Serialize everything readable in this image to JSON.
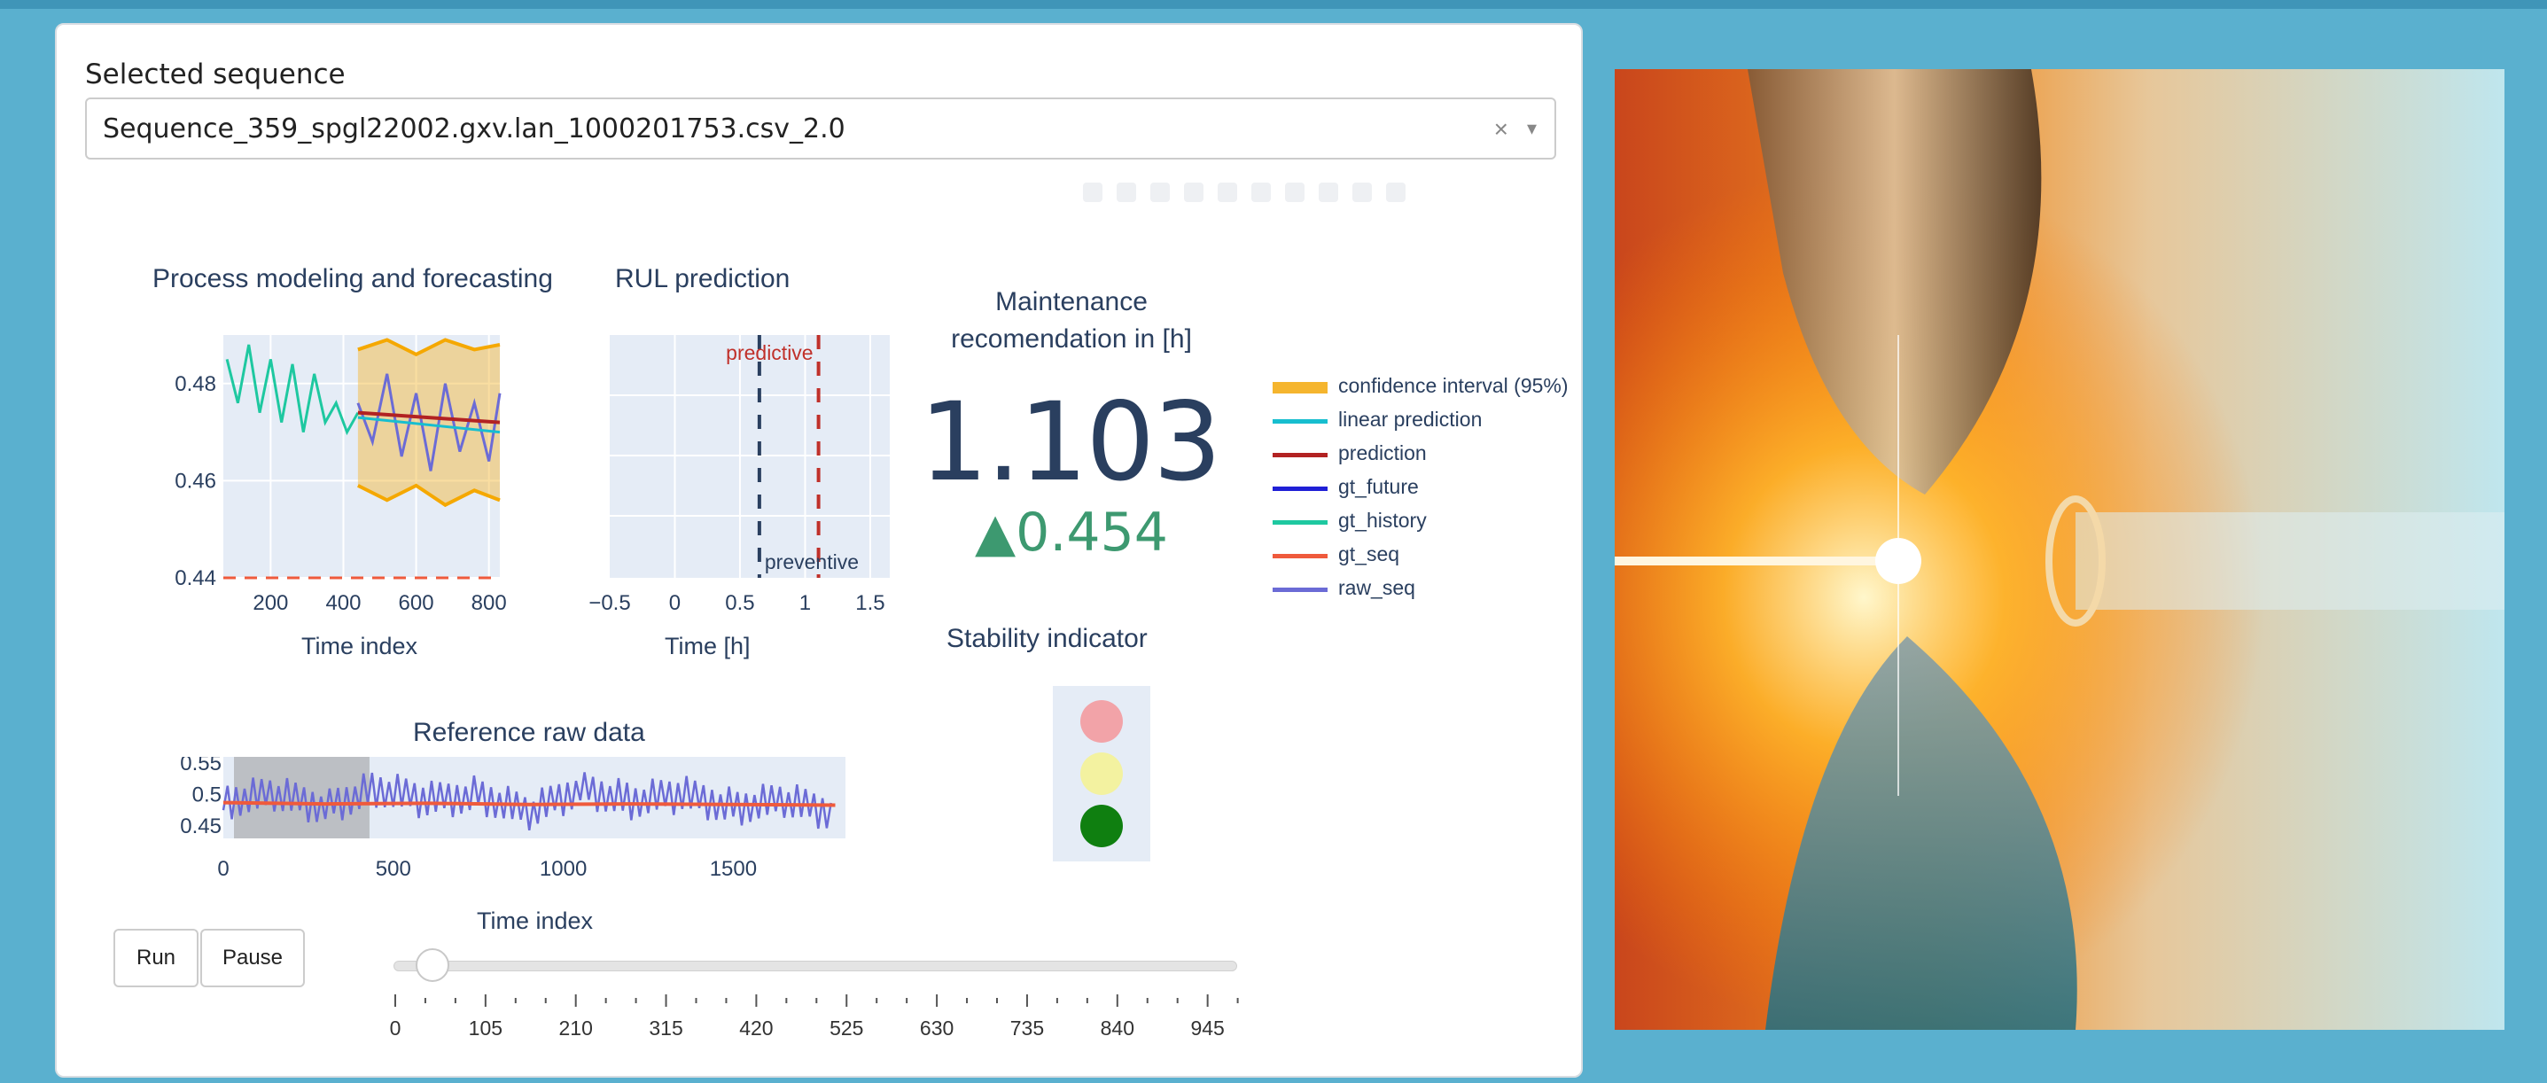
{
  "selector": {
    "label": "Selected sequence",
    "value": "Sequence_359_spgl22002.gxv.lan_1000201753.csv_2.0",
    "clear_icon": "×",
    "caret_icon": "▾"
  },
  "forecast_plot": {
    "title": "Process modeling and forecasting",
    "x_title": "Time index",
    "x_ticks": [
      "200",
      "400",
      "600",
      "800"
    ],
    "y_ticks": [
      "0.48",
      "0.46",
      "0.44"
    ]
  },
  "rul_plot": {
    "title": "RUL prediction",
    "x_title": "Time [h]",
    "x_ticks": [
      "−0.5",
      "0",
      "0.5",
      "1",
      "1.5"
    ],
    "label_predictive": "predictive",
    "label_preventive": "preventive"
  },
  "maintenance": {
    "title_line1": "Maintenance",
    "title_line2": "recomendation in [h]",
    "value": "1.103",
    "delta": "▲0.454"
  },
  "legend": {
    "items": [
      {
        "label": "confidence interval (95%)",
        "color": "#f5b52e"
      },
      {
        "label": "linear prediction",
        "color": "#17becf"
      },
      {
        "label": "prediction",
        "color": "#b22222"
      },
      {
        "label": "gt_future",
        "color": "#1f1fd6"
      },
      {
        "label": "gt_history",
        "color": "#1ec8a0"
      },
      {
        "label": "gt_seq",
        "color": "#ef5a3c"
      },
      {
        "label": "raw_seq",
        "color": "#6b6bd6"
      }
    ]
  },
  "stability": {
    "title": "Stability indicator",
    "colors": {
      "red": "#f2a3a8",
      "yellow": "#f3f2a0",
      "green": "#0f7f10"
    }
  },
  "raw_plot": {
    "title": "Reference raw data",
    "x_title": "Time index",
    "x_ticks": [
      "0",
      "500",
      "1000",
      "1500"
    ],
    "y_ticks": [
      "0.55",
      "0.5",
      "0.45"
    ]
  },
  "controls": {
    "run_label": "Run",
    "pause_label": "Pause",
    "slider_value": 35,
    "slider_ticks": [
      "0",
      "105",
      "210",
      "315",
      "420",
      "525",
      "630",
      "735",
      "840",
      "945"
    ]
  },
  "chart_data": [
    {
      "type": "line",
      "title": "Process modeling and forecasting",
      "xlabel": "Time index",
      "ylabel": "",
      "xlim": [
        70,
        830
      ],
      "ylim": [
        0.44,
        0.49
      ],
      "series": [
        {
          "name": "gt_history",
          "x": [
            80,
            110,
            140,
            170,
            200,
            230,
            260,
            290,
            320,
            350,
            380,
            410,
            440
          ],
          "values": [
            0.485,
            0.476,
            0.488,
            0.474,
            0.485,
            0.472,
            0.484,
            0.47,
            0.482,
            0.472,
            0.476,
            0.47,
            0.474
          ]
        },
        {
          "name": "raw_seq",
          "x": [
            440,
            480,
            520,
            560,
            600,
            640,
            680,
            720,
            760,
            800,
            830
          ],
          "values": [
            0.476,
            0.468,
            0.482,
            0.465,
            0.478,
            0.462,
            0.48,
            0.466,
            0.476,
            0.464,
            0.478
          ]
        },
        {
          "name": "prediction",
          "x": [
            440,
            830
          ],
          "values": [
            0.474,
            0.472
          ]
        },
        {
          "name": "linear prediction",
          "x": [
            440,
            830
          ],
          "values": [
            0.473,
            0.47
          ]
        },
        {
          "name": "confidence upper",
          "x": [
            440,
            520,
            600,
            680,
            760,
            830
          ],
          "values": [
            0.487,
            0.489,
            0.486,
            0.489,
            0.487,
            0.488
          ]
        },
        {
          "name": "confidence lower",
          "x": [
            440,
            520,
            600,
            680,
            760,
            830
          ],
          "values": [
            0.459,
            0.456,
            0.459,
            0.455,
            0.458,
            0.456
          ]
        }
      ]
    },
    {
      "type": "scatter",
      "title": "RUL prediction",
      "xlabel": "Time [h]",
      "xlim": [
        -0.5,
        1.65
      ],
      "series": [
        {
          "name": "preventive",
          "x": [
            0.649
          ],
          "values": [
            0
          ]
        },
        {
          "name": "predictive",
          "x": [
            1.103
          ],
          "values": [
            0
          ]
        }
      ]
    },
    {
      "type": "line",
      "title": "Reference raw data",
      "xlabel": "Time index",
      "xlim": [
        0,
        1830
      ],
      "ylim": [
        0.43,
        0.56
      ],
      "highlight_range": [
        0,
        430
      ],
      "series": [
        {
          "name": "raw_seq",
          "x": [
            0,
            150,
            300,
            450,
            600,
            750,
            900,
            1050,
            1200,
            1350,
            1500,
            1650,
            1800
          ],
          "values": [
            0.49,
            0.5,
            0.48,
            0.51,
            0.49,
            0.5,
            0.47,
            0.51,
            0.49,
            0.5,
            0.48,
            0.49,
            0.47
          ]
        },
        {
          "name": "gt_seq",
          "x": [
            0,
            300,
            600,
            900,
            1200,
            1500,
            1800
          ],
          "values": [
            0.487,
            0.485,
            0.486,
            0.484,
            0.485,
            0.484,
            0.483
          ]
        }
      ]
    }
  ]
}
